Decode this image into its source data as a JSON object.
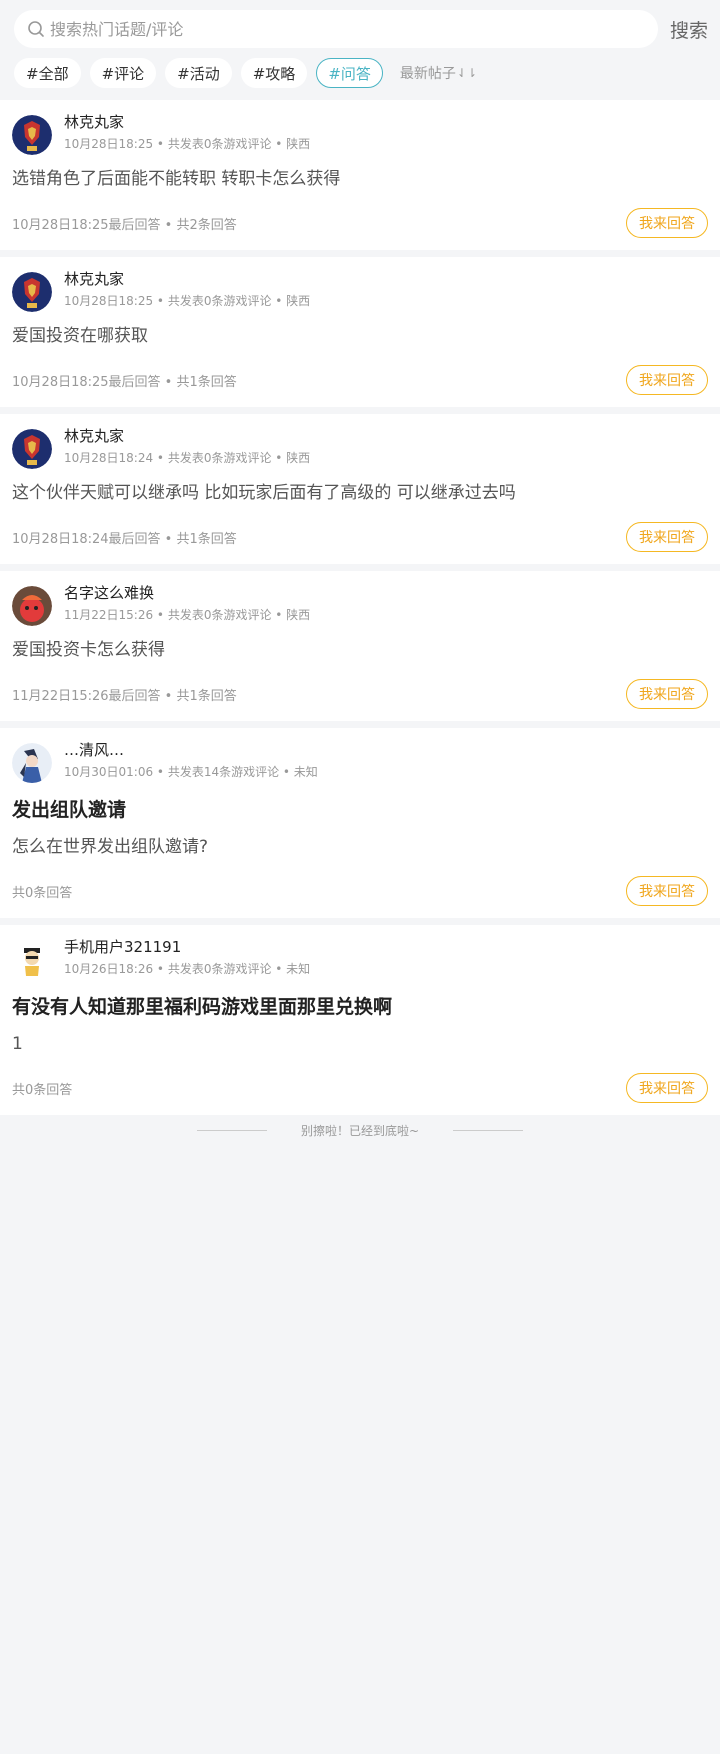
{
  "search": {
    "placeholder": "搜索热门话题/评论",
    "button": "搜索"
  },
  "tags": [
    "#全部",
    "#评论",
    "#活动",
    "#攻略",
    "#问答"
  ],
  "sort": {
    "label": "最新帖子",
    "arrow": "⇃⇂"
  },
  "posts": [
    {
      "user": "林克丸家",
      "sub": "10月28日18:25 • 共发表0条游戏评论 • 陕西",
      "title": "",
      "body": "选错角色了后面能不能转职 转职卡怎么获得",
      "stat": "10月28日18:25最后回答 • 共2条回答",
      "action": "我来回答"
    },
    {
      "user": "林克丸家",
      "sub": "10月28日18:25 • 共发表0条游戏评论 • 陕西",
      "title": "",
      "body": "爱国投资在哪获取",
      "stat": "10月28日18:25最后回答 • 共1条回答",
      "action": "我来回答"
    },
    {
      "user": "林克丸家",
      "sub": "10月28日18:24 • 共发表0条游戏评论 • 陕西",
      "title": "",
      "body": "这个伙伴天赋可以继承吗 比如玩家后面有了高级的 可以继承过去吗",
      "stat": "10月28日18:24最后回答 • 共1条回答",
      "action": "我来回答"
    },
    {
      "user": "名字这么难换",
      "sub": "11月22日15:26 • 共发表0条游戏评论 • 陕西",
      "title": "",
      "body": "爱国投资卡怎么获得",
      "stat": "11月22日15:26最后回答 • 共1条回答",
      "action": "我来回答"
    },
    {
      "user": "…清风…",
      "sub": "10月30日01:06 • 共发表14条游戏评论 • 未知",
      "title": "发出组队邀请",
      "body": "怎么在世界发出组队邀请?",
      "stat": "共0条回答",
      "action": "我来回答"
    },
    {
      "user": "手机用户321191",
      "sub": "10月26日18:26 • 共发表0条游戏评论 • 未知",
      "title": "有没有人知道那里福利码游戏里面那里兑换啊",
      "body": "1",
      "stat": "共0条回答",
      "action": "我来回答"
    }
  ],
  "end_text": "别擦啦！已经到底啦~",
  "colors": {
    "accent_tag": "#4ab4c4",
    "answer_button": "#f0a61c",
    "background": "#f4f5f7"
  }
}
